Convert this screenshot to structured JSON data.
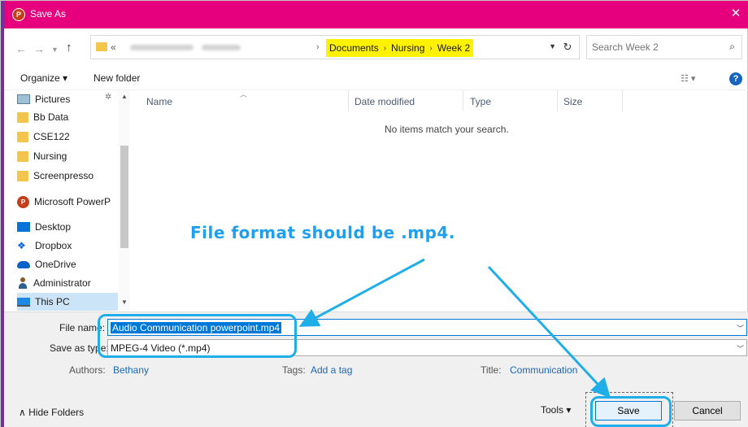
{
  "window": {
    "title": "Save As",
    "app_icon": "P",
    "close_glyph": "✕",
    "accent": "#e6007e"
  },
  "address": {
    "chevron": "«",
    "crumbs": [
      "Documents",
      "Nursing",
      "Week 2"
    ],
    "crumb_highlight": "#fff200"
  },
  "search": {
    "placeholder": "Search Week 2"
  },
  "toolbar": {
    "organize_label": "Organize ▾",
    "newfolder_label": "New folder",
    "help_glyph": "?"
  },
  "nav": {
    "items": [
      {
        "label": "Pictures",
        "icon": "pictures-icon"
      },
      {
        "label": "Bb Data",
        "icon": "folder-icon"
      },
      {
        "label": "CSE122",
        "icon": "folder-icon"
      },
      {
        "label": "Nursing",
        "icon": "folder-icon"
      },
      {
        "label": "Screenpresso",
        "icon": "folder-icon"
      },
      {
        "label": "Microsoft PowerP",
        "icon": "powerpoint-icon"
      },
      {
        "label": "Desktop",
        "icon": "desktop-icon"
      },
      {
        "label": "Dropbox",
        "icon": "dropbox-icon"
      },
      {
        "label": "OneDrive",
        "icon": "onedrive-icon"
      },
      {
        "label": "Administrator",
        "icon": "user-icon"
      },
      {
        "label": "This PC",
        "icon": "this-pc-icon"
      }
    ]
  },
  "filelist": {
    "columns": [
      "Name",
      "Date modified",
      "Type",
      "Size"
    ],
    "empty_message": "No items match your search."
  },
  "form": {
    "filename_label": "File name:",
    "filename_value": "Audio Communication powerpoint.mp4",
    "savetype_label": "Save as type:",
    "savetype_value": "MPEG-4 Video (*.mp4)",
    "authors_label": "Authors:",
    "authors_value": "Bethany",
    "tags_label": "Tags:",
    "tags_value": "Add a tag",
    "title_label": "Title:",
    "title_value": "Communication"
  },
  "footer": {
    "hide_folders_label": "Hide Folders",
    "tools_label": "Tools",
    "save_label": "Save",
    "cancel_label": "Cancel"
  },
  "annotation": {
    "text": "File format should be .mp4.",
    "color": "#20aee8"
  }
}
